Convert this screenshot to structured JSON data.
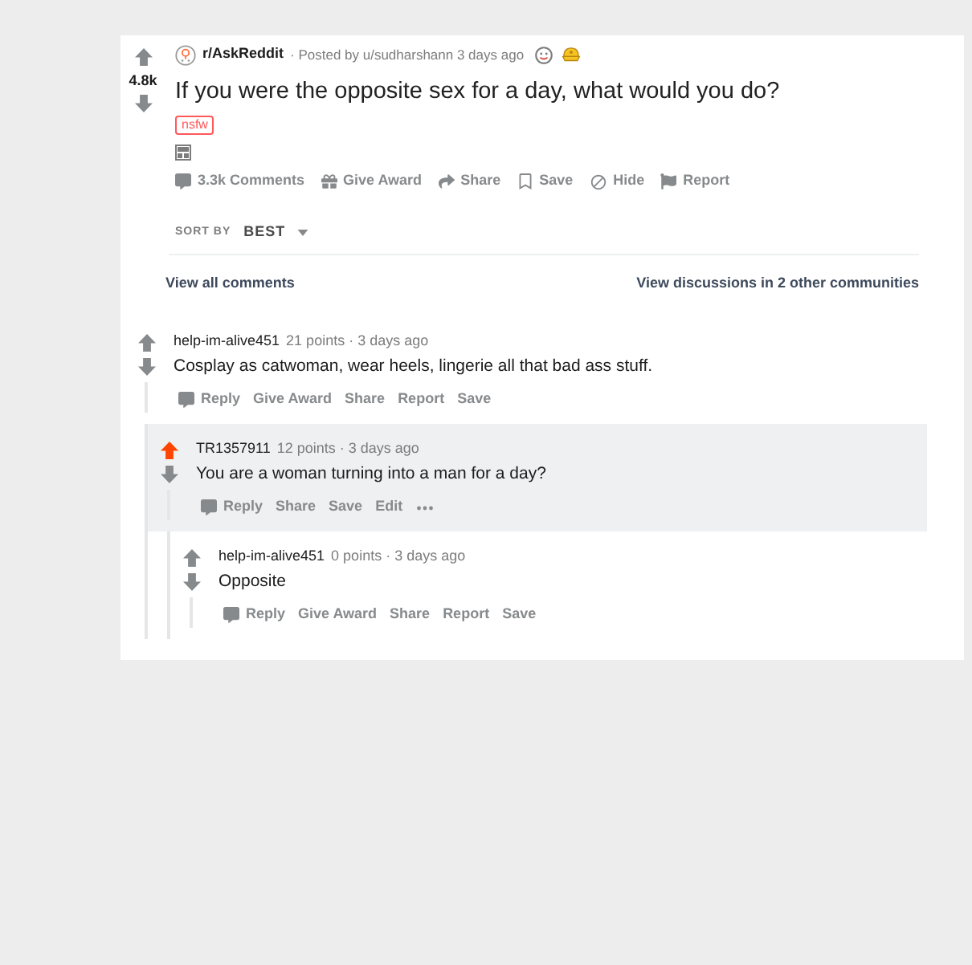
{
  "post": {
    "score": "4.8k",
    "upvoted": false,
    "subreddit": "r/AskReddit",
    "byline": "· Posted by u/sudharshann 3 days ago",
    "title": "If you were the opposite sex for a day, what would you do?",
    "tags": [
      {
        "label": "nsfw"
      }
    ],
    "actions": [
      {
        "kind": "comments",
        "label": "3.3k Comments"
      },
      {
        "kind": "award",
        "label": "Give Award"
      },
      {
        "kind": "share",
        "label": "Share"
      },
      {
        "kind": "save",
        "label": "Save"
      },
      {
        "kind": "hide",
        "label": "Hide"
      },
      {
        "kind": "report",
        "label": "Report"
      }
    ]
  },
  "sort": {
    "label": "SORT BY",
    "value": "BEST"
  },
  "links": {
    "all_comments": "View all comments",
    "other_discussions": "View discussions in 2 other communities"
  },
  "comments": [
    {
      "author": "help-im-alive451",
      "meta": "21 points · 3 days ago",
      "body": "Cosplay as catwoman, wear heels, lingerie all that bad ass stuff.",
      "upvoted": false,
      "highlighted": false,
      "actions": [
        {
          "kind": "reply",
          "label": "Reply"
        },
        {
          "kind": "award",
          "label": "Give Award"
        },
        {
          "kind": "share",
          "label": "Share"
        },
        {
          "kind": "report",
          "label": "Report"
        },
        {
          "kind": "save",
          "label": "Save"
        }
      ],
      "children": [
        {
          "author": "TR1357911",
          "meta": "12 points · 3 days ago",
          "body": "You are a woman turning into a man for a day?",
          "upvoted": true,
          "highlighted": true,
          "actions": [
            {
              "kind": "reply",
              "label": "Reply"
            },
            {
              "kind": "share",
              "label": "Share"
            },
            {
              "kind": "save",
              "label": "Save"
            },
            {
              "kind": "edit",
              "label": "Edit"
            },
            {
              "kind": "more"
            }
          ],
          "children": [
            {
              "author": "help-im-alive451",
              "meta": "0 points · 3 days ago",
              "body": "Opposite",
              "upvoted": false,
              "highlighted": false,
              "actions": [
                {
                  "kind": "reply",
                  "label": "Reply"
                },
                {
                  "kind": "award",
                  "label": "Give Award"
                },
                {
                  "kind": "share",
                  "label": "Share"
                },
                {
                  "kind": "report",
                  "label": "Report"
                },
                {
                  "kind": "save",
                  "label": "Save"
                }
              ]
            }
          ]
        }
      ]
    }
  ]
}
